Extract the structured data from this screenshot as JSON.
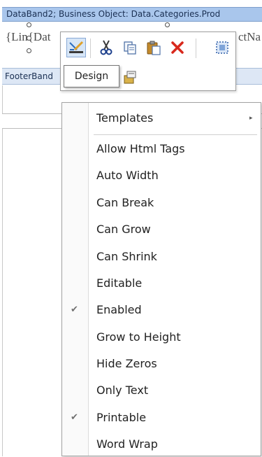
{
  "designer": {
    "databand_header": "DataBand2; Business Object: Data.Categories.Prod",
    "band_text_left": "{Lin{Dat",
    "band_text_right": "ctNa",
    "footer_header": "FooterBand"
  },
  "toolbar": {
    "buttons": [
      {
        "name": "design",
        "icon": "design-icon",
        "active": true
      },
      {
        "name": "cut",
        "icon": "scissors-icon"
      },
      {
        "name": "copy",
        "icon": "copy-icon"
      },
      {
        "name": "paste",
        "icon": "paste-icon"
      },
      {
        "name": "delete",
        "icon": "red-x-icon"
      },
      {
        "name": "select-all",
        "icon": "select-all-icon"
      },
      {
        "name": "properties",
        "icon": "properties-icon"
      }
    ],
    "tooltip": "Design"
  },
  "menu": {
    "templates_label": "Templates",
    "items": [
      {
        "label": "Allow Html Tags",
        "checked": false
      },
      {
        "label": "Auto Width",
        "checked": false
      },
      {
        "label": "Can Break",
        "checked": false
      },
      {
        "label": "Can Grow",
        "checked": false
      },
      {
        "label": "Can Shrink",
        "checked": false
      },
      {
        "label": "Editable",
        "checked": false
      },
      {
        "label": "Enabled",
        "checked": true
      },
      {
        "label": "Grow to Height",
        "checked": false
      },
      {
        "label": "Hide Zeros",
        "checked": false
      },
      {
        "label": "Only Text",
        "checked": false
      },
      {
        "label": "Printable",
        "checked": true
      },
      {
        "label": "Word Wrap",
        "checked": false
      }
    ],
    "check_glyph": "✔",
    "submenu_arrow": "▸"
  }
}
